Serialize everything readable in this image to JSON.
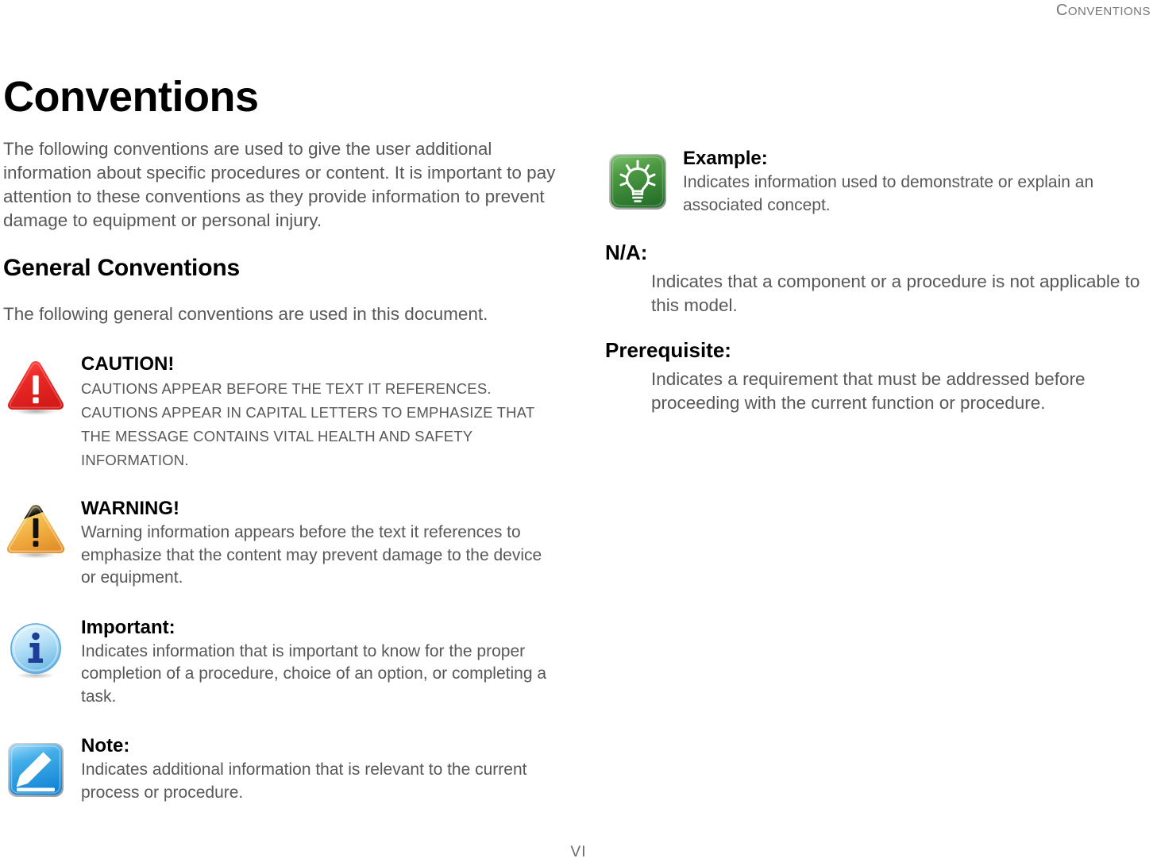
{
  "header": {
    "running_head": "CONVENTIONS",
    "running_head_first": "C",
    "running_head_rest": "ONVENTIONS"
  },
  "title": "Conventions",
  "intro": "The following conventions are used to give the user additional information about specific procedures or content. It is important to pay attention to these conventions as they provide information to prevent damage to equipment or personal injury.",
  "section": {
    "heading": "General Conventions",
    "lead": "The following general conventions are used in this document."
  },
  "admonitions": [
    {
      "icon": "caution-triangle-icon",
      "title": "CAUTION!",
      "body": "CAUTIONS APPEAR BEFORE THE TEXT IT REFERENCES. CAUTIONS APPEAR IN CAPITAL LETTERS TO EMPHASIZE THAT THE MESSAGE CONTAINS VITAL HEALTH AND SAFETY INFORMATION.",
      "color": "#e8232a"
    },
    {
      "icon": "warning-triangle-icon",
      "title": "WARNING!",
      "body": "Warning information appears before the text it references to emphasize that the content may prevent damage to the device or equipment.",
      "color": "#efa83a"
    },
    {
      "icon": "important-info-icon",
      "title": "Important:",
      "body": "Indicates information that is important to know for the proper completion of a procedure, choice of an option, or completing a task.",
      "color": "#8ecbee"
    },
    {
      "icon": "note-pencil-icon",
      "title": "Note:",
      "body": "Indicates additional information that is relevant to the current process or procedure.",
      "color": "#2496dd"
    }
  ],
  "example": {
    "icon": "example-lightbulb-icon",
    "title": "Example:",
    "body": "Indicates information used to demonstrate or explain an associated concept.",
    "color": "#3f8f3a"
  },
  "definitions": [
    {
      "term": "N/A:",
      "description": "Indicates that a component or a procedure is not applicable to this model."
    },
    {
      "term": "Prerequisite:",
      "description": "Indicates a requirement that must be addressed before proceeding with the current function or procedure."
    }
  ],
  "footer": {
    "page_number": "VI"
  }
}
